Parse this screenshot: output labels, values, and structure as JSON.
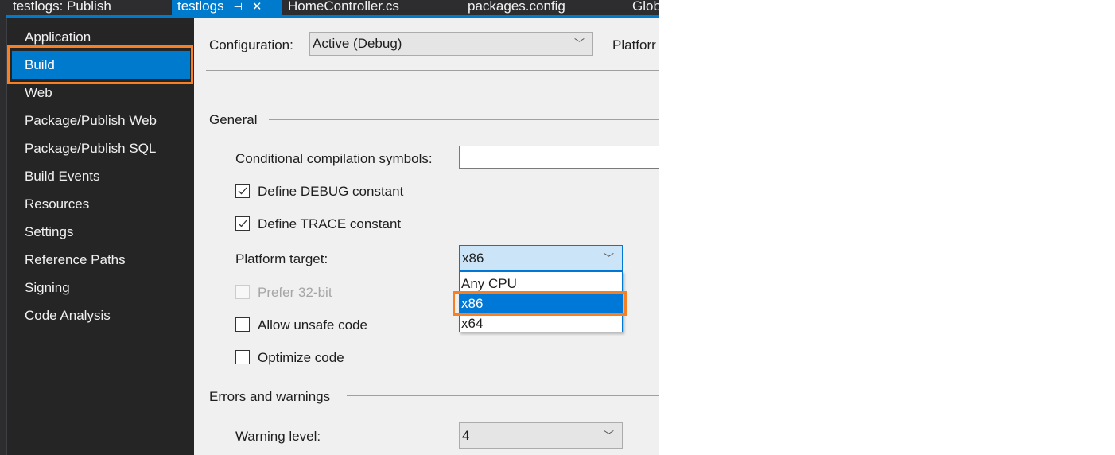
{
  "tabs": [
    {
      "label": "testlogs: Publish",
      "active": false
    },
    {
      "label": "testlogs",
      "active": true,
      "pin_icon": "pin-icon",
      "close_icon": "close-icon"
    },
    {
      "label": "HomeController.cs",
      "active": false
    },
    {
      "label": "packages.config",
      "active": false
    },
    {
      "label": "Glob",
      "active": false
    }
  ],
  "sidebar": {
    "items": [
      {
        "label": "Application"
      },
      {
        "label": "Build",
        "selected": true
      },
      {
        "label": "Web"
      },
      {
        "label": "Package/Publish Web"
      },
      {
        "label": "Package/Publish SQL"
      },
      {
        "label": "Build Events"
      },
      {
        "label": "Resources"
      },
      {
        "label": "Settings"
      },
      {
        "label": "Reference Paths"
      },
      {
        "label": "Signing"
      },
      {
        "label": "Code Analysis"
      }
    ]
  },
  "header": {
    "configuration_label": "Configuration:",
    "configuration_value": "Active (Debug)",
    "platform_label": "Platforr"
  },
  "general": {
    "section_title": "General",
    "symbols_label": "Conditional compilation symbols:",
    "symbols_value": "",
    "define_debug": {
      "label": "Define DEBUG constant",
      "checked": true
    },
    "define_trace": {
      "label": "Define TRACE constant",
      "checked": true
    },
    "platform_target_label": "Platform target:",
    "platform_target_value": "x86",
    "platform_options": [
      "Any CPU",
      "x86",
      "x64"
    ],
    "platform_selected": "x86",
    "prefer32": {
      "label": "Prefer 32-bit",
      "checked": false,
      "disabled": true
    },
    "allow_unsafe": {
      "label": "Allow unsafe code",
      "checked": false
    },
    "optimize": {
      "label": "Optimize code",
      "checked": false
    }
  },
  "errors": {
    "section_title": "Errors and warnings",
    "warning_level_label": "Warning level:",
    "warning_level_value": "4"
  },
  "colors": {
    "accent": "#007acc",
    "highlight": "#f58025",
    "dropdown_selected": "#0078d7"
  }
}
